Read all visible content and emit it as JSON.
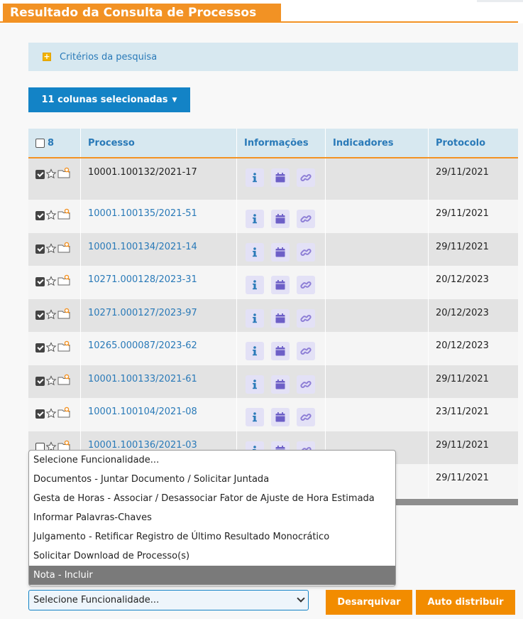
{
  "page": {
    "title": "Resultado da Consulta de Processos"
  },
  "criteria": {
    "label": "Critérios da pesquisa"
  },
  "columns_button": {
    "label": "11 colunas selecionadas"
  },
  "table": {
    "selected_count": "8",
    "headers": {
      "processo": "Processo",
      "informacoes": "Informações",
      "indicadores": "Indicadores",
      "protocolo": "Protocolo"
    },
    "rows": [
      {
        "processo": "10001.100132/2021-17",
        "protocolo": "29/11/2021",
        "checked": true,
        "link": false
      },
      {
        "processo": "10001.100135/2021-51",
        "protocolo": "29/11/2021",
        "checked": true,
        "link": true
      },
      {
        "processo": "10001.100134/2021-14",
        "protocolo": "29/11/2021",
        "checked": true,
        "link": true
      },
      {
        "processo": "10271.000128/2023-31",
        "protocolo": "20/12/2023",
        "checked": true,
        "link": true
      },
      {
        "processo": "10271.000127/2023-97",
        "protocolo": "20/12/2023",
        "checked": true,
        "link": true
      },
      {
        "processo": "10265.000087/2023-62",
        "protocolo": "20/12/2023",
        "checked": true,
        "link": true
      },
      {
        "processo": "10001.100133/2021-61",
        "protocolo": "29/11/2021",
        "checked": true,
        "link": true
      },
      {
        "processo": "10001.100104/2021-08",
        "protocolo": "23/11/2021",
        "checked": true,
        "link": true
      },
      {
        "processo": "10001.100136/2021-03",
        "protocolo": "29/11/2021",
        "checked": false,
        "link": true
      },
      {
        "processo": "",
        "protocolo": "29/11/2021",
        "checked": false,
        "link": true
      }
    ]
  },
  "dropdown": {
    "options": [
      "Selecione Funcionalidade...",
      "Documentos - Juntar Documento / Solicitar Juntada",
      "Gesta de Horas - Associar / Desassociar Fator de Ajuste de Hora Estimada",
      "Informar Palavras-Chaves",
      "Julgamento - Retificar Registro de Último Resultado Monocrático",
      "Solicitar Download de Processo(s)",
      "Nota - Incluir"
    ],
    "highlighted_index": 6
  },
  "select": {
    "value": "Selecione Funcionalidade..."
  },
  "buttons": {
    "desarquivar": "Desarquivar",
    "auto_distribuir": "Auto distribuir"
  },
  "colors": {
    "orange": "#f29224",
    "blue": "#1383c6",
    "link": "#2a7ab8",
    "icon_purple": "#7b6fd0"
  }
}
